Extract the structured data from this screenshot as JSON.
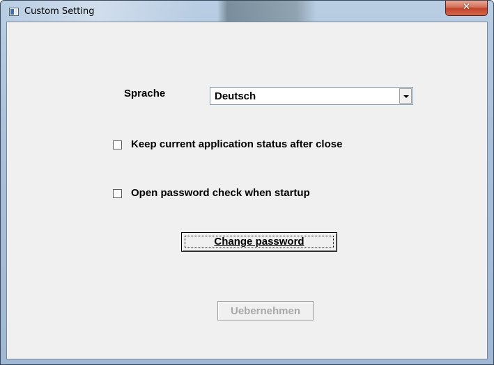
{
  "window": {
    "title": "Custom Setting",
    "close_glyph": "✕"
  },
  "settings": {
    "language_label": "Sprache",
    "language_value": "Deutsch",
    "keep_status_label": "Keep current application status after close",
    "keep_status_checked": false,
    "password_check_label": "Open password check when startup",
    "password_check_checked": false
  },
  "buttons": {
    "change_password_label": "Change password",
    "apply_label": "Uebernehmen",
    "apply_enabled": false
  },
  "icons": {
    "window": "app-window-icon",
    "close": "close-icon",
    "dropdown": "chevron-down-icon"
  }
}
